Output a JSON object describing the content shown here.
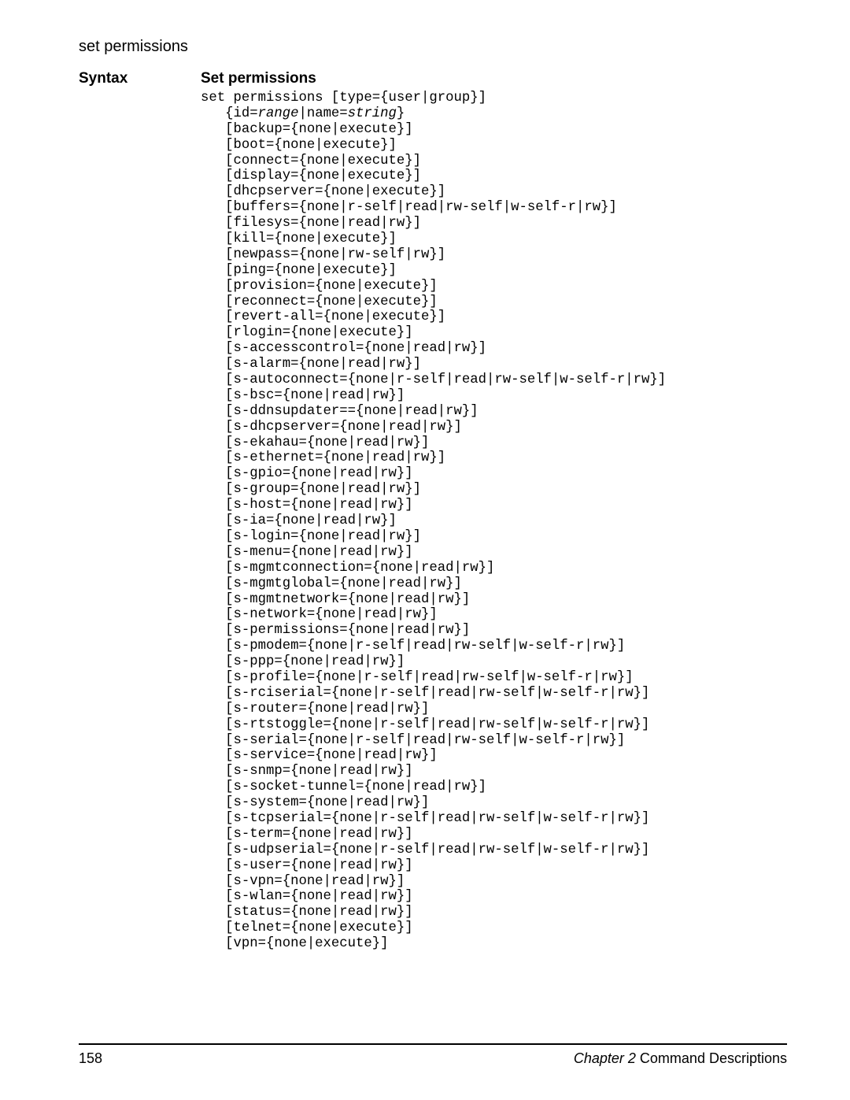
{
  "header": {
    "title": "set permissions"
  },
  "syntax_label": "Syntax",
  "subheading": "Set permissions",
  "code": {
    "line1_a": "set permissions [type={user|group}]",
    "line2_a": "   {id=",
    "line2_b": "range",
    "line2_c": "|name=",
    "line2_d": "string",
    "line2_e": "}",
    "line3": "   [backup={none|execute}]",
    "line4": "   [boot={none|execute}]",
    "line5": "   [connect={none|execute}]",
    "line6": "   [display={none|execute}]",
    "line7": "   [dhcpserver={none|execute}]",
    "line8": "   [buffers={none|r-self|read|rw-self|w-self-r|rw}]",
    "line9": "   [filesys={none|read|rw}]",
    "line10": "   [kill={none|execute}]",
    "line11": "   [newpass={none|rw-self|rw}]",
    "line12": "   [ping={none|execute}]",
    "line13": "   [provision={none|execute}]",
    "line14": "   [reconnect={none|execute}]",
    "line15": "   [revert-all={none|execute}]",
    "line16": "   [rlogin={none|execute}]",
    "line17": "   [s-accesscontrol={none|read|rw}]",
    "line18": "   [s-alarm={none|read|rw}]",
    "line19": "   [s-autoconnect={none|r-self|read|rw-self|w-self-r|rw}]",
    "line20": "   [s-bsc={none|read|rw}]",
    "line21": "   [s-ddnsupdater=={none|read|rw}]",
    "line22": "   [s-dhcpserver={none|read|rw}]",
    "line23": "   [s-ekahau={none|read|rw}]",
    "line24": "   [s-ethernet={none|read|rw}]",
    "line25": "   [s-gpio={none|read|rw}]",
    "line26": "   [s-group={none|read|rw}]",
    "line27": "   [s-host={none|read|rw}]",
    "line28": "   [s-ia={none|read|rw}]",
    "line29": "   [s-login={none|read|rw}]",
    "line30": "   [s-menu={none|read|rw}]",
    "line31": "   [s-mgmtconnection={none|read|rw}]",
    "line32": "   [s-mgmtglobal={none|read|rw}]",
    "line33": "   [s-mgmtnetwork={none|read|rw}]",
    "line34": "   [s-network={none|read|rw}]",
    "line35": "   [s-permissions={none|read|rw}]",
    "line36": "   [s-pmodem={none|r-self|read|rw-self|w-self-r|rw}]",
    "line37": "   [s-ppp={none|read|rw}]",
    "line38": "   [s-profile={none|r-self|read|rw-self|w-self-r|rw}]",
    "line39": "   [s-rciserial={none|r-self|read|rw-self|w-self-r|rw}]",
    "line40": "   [s-router={none|read|rw}]",
    "line41": "   [s-rtstoggle={none|r-self|read|rw-self|w-self-r|rw}]",
    "line42": "   [s-serial={none|r-self|read|rw-self|w-self-r|rw}]",
    "line43": "   [s-service={none|read|rw}]",
    "line44": "   [s-snmp={none|read|rw}]",
    "line45": "   [s-socket-tunnel={none|read|rw}]",
    "line46": "   [s-system={none|read|rw}]",
    "line47": "   [s-tcpserial={none|r-self|read|rw-self|w-self-r|rw}]",
    "line48": "   [s-term={none|read|rw}]",
    "line49": "   [s-udpserial={none|r-self|read|rw-self|w-self-r|rw}]",
    "line50": "   [s-user={none|read|rw}]",
    "line51": "   [s-vpn={none|read|rw}]",
    "line52": "   [s-wlan={none|read|rw}]",
    "line53": "   [status={none|read|rw}]",
    "line54": "   [telnet={none|execute}]",
    "line55": "   [vpn={none|execute}]"
  },
  "footer": {
    "page": "158",
    "chapter": "Chapter 2",
    "chapter_title": "   Command Descriptions"
  }
}
